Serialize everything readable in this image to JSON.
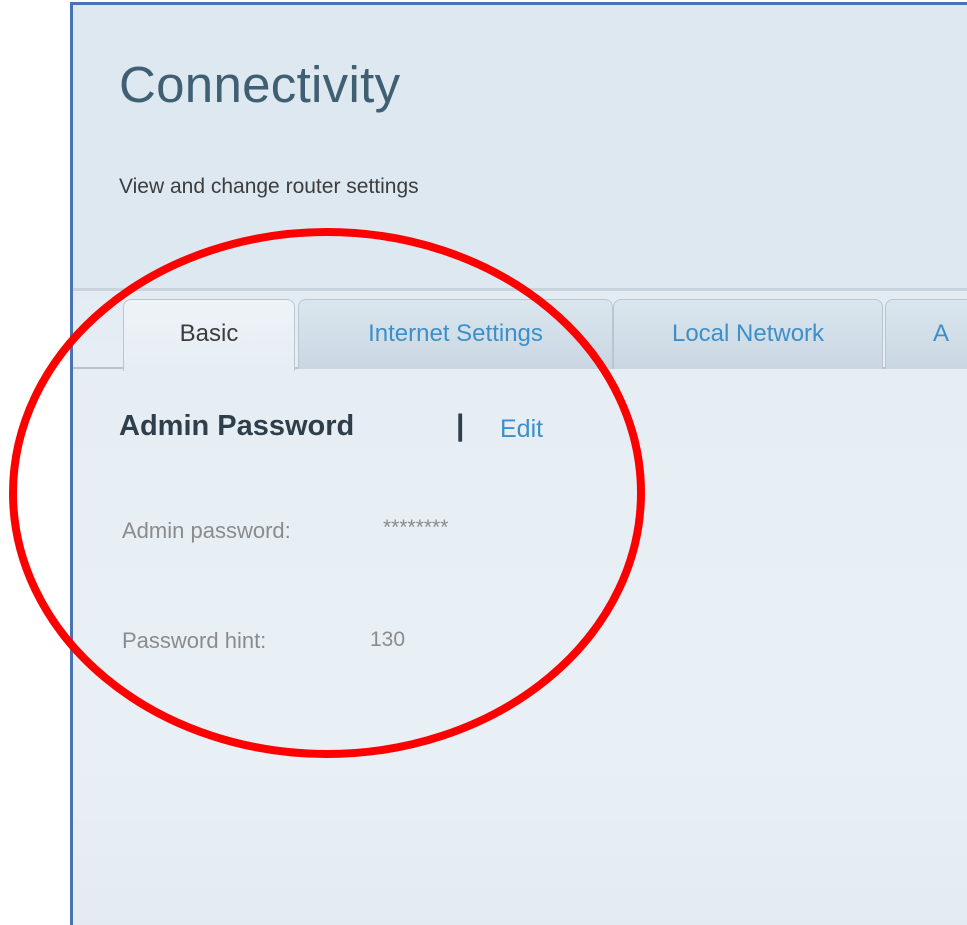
{
  "header": {
    "title": "Connectivity",
    "subtitle": "View and change router settings"
  },
  "tabs": [
    {
      "label": "Basic",
      "active": true
    },
    {
      "label": "Internet Settings",
      "active": false
    },
    {
      "label": "Local Network",
      "active": false
    },
    {
      "label": "A",
      "active": false
    }
  ],
  "admin_section": {
    "heading": "Admin Password",
    "separator": "|",
    "edit_label": "Edit",
    "password_label": "Admin password:",
    "password_value": "********",
    "hint_label": "Password hint:",
    "hint_value": "130"
  },
  "colors": {
    "annotation_circle": "#ff0000",
    "panel_border": "#4a73b3",
    "link": "#3d8fc9"
  }
}
